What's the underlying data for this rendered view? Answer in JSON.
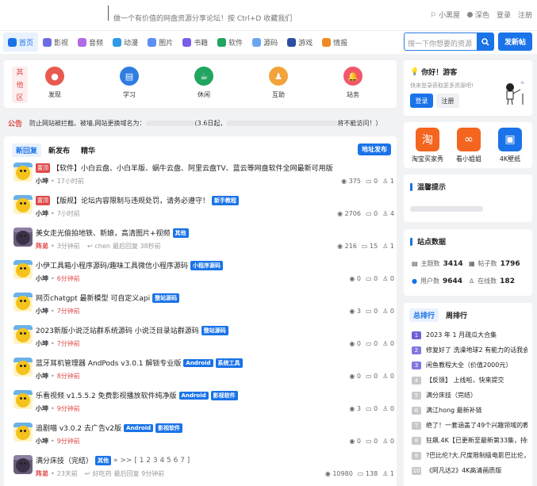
{
  "header": {
    "slogan": "做一个有价值的网盘资源分享论坛！按 Ctrl+D 收藏我们",
    "links": [
      "小黑屋",
      "深色",
      "登录",
      "注册"
    ]
  },
  "nav": {
    "items": [
      "首页",
      "影视",
      "音频",
      "动漫",
      "图片",
      "书籍",
      "软件",
      "源码",
      "游戏",
      "情报"
    ],
    "icon_colors": [
      "#1a73e8",
      "#6c6ce5",
      "#b06ae5",
      "#2f9be8",
      "#5b8ff0",
      "#7a5de8",
      "#22a560",
      "#6aa5f0",
      "#2b4fa3",
      "#f08a24"
    ],
    "search_placeholder": "搜一下你想要的资源",
    "post_button": "发新帖"
  },
  "quick": {
    "category": "其他区",
    "items": [
      "发现",
      "学习",
      "休闲",
      "互助",
      "站务"
    ],
    "colors": [
      "#e85a4f",
      "#2f7de1",
      "#22a560",
      "#f2a33a",
      "#f2566a"
    ]
  },
  "notice": {
    "tag": "公告",
    "text_a": "防止网站被拦截、被墙,网站更换域名为：",
    "text_b": "(3.6日起，",
    "text_c": "将不能访问！）"
  },
  "feed": {
    "tabs": [
      "新回复",
      "新发布",
      "精华"
    ],
    "address_button": "地址发布",
    "posts": [
      {
        "top": "置顶",
        "title": "【软件】小白云盘、小白羊版、蜗牛云盘、阿里云盘TV、蓝云等网盘软件全网最新可用版",
        "labels": [],
        "author": "小坤",
        "time": "17小时前",
        "reply_user": "",
        "reply_time": "",
        "views": "375",
        "replies": "0",
        "likes": "1",
        "dark": false
      },
      {
        "top": "置顶",
        "title": "【版规】论坛内容限制与违规处罚，请务必遵守！",
        "labels": [
          "新手教程"
        ],
        "author": "小坤",
        "time": "7小时前",
        "reply_user": "",
        "reply_time": "",
        "views": "2706",
        "replies": "0",
        "likes": "4",
        "dark": false
      },
      {
        "top": "",
        "title": "美女走光偷拍地铁、新娘，高清图片+视频",
        "labels": [
          "其他"
        ],
        "author": "阵弟",
        "time": "3分钟前",
        "reply_user": "chen",
        "reply_time": "最后回复 38秒前",
        "views": "216",
        "replies": "15",
        "likes": "1",
        "dark": true
      },
      {
        "top": "",
        "title": "小伊工具箱小程序源码/趣味工具微信小程序源码",
        "labels": [
          "小程序源码"
        ],
        "author": "小坤",
        "time": "6分钟前",
        "reply_user": "",
        "reply_time": "",
        "views": "0",
        "replies": "0",
        "likes": "0",
        "dark": false
      },
      {
        "top": "",
        "title": "网页chatgpt 最新模型 可自定义api",
        "labels": [
          "整站源码"
        ],
        "author": "小坤",
        "time": "7分钟前",
        "reply_user": "",
        "reply_time": "",
        "views": "3",
        "replies": "0",
        "likes": "0",
        "dark": false
      },
      {
        "top": "",
        "title": "2023新版小说泛站群系统源码 小说泛目录站群源码",
        "labels": [
          "整站源码"
        ],
        "author": "小坤",
        "time": "7分钟前",
        "reply_user": "",
        "reply_time": "",
        "views": "0",
        "replies": "0",
        "likes": "0",
        "dark": false
      },
      {
        "top": "",
        "title": "蓝牙耳机管理器 AndPods v3.0.1 解锁专业版",
        "labels": [
          "Android",
          "系统工具"
        ],
        "author": "小坤",
        "time": "8分钟前",
        "reply_user": "",
        "reply_time": "",
        "views": "0",
        "replies": "0",
        "likes": "0",
        "dark": false
      },
      {
        "top": "",
        "title": "乐看视频 v1.5.5.2 免费影视播放软件纯净版",
        "labels": [
          "Android",
          "影视软件"
        ],
        "author": "小坤",
        "time": "9分钟前",
        "reply_user": "",
        "reply_time": "",
        "views": "3",
        "replies": "0",
        "likes": "0",
        "dark": false
      },
      {
        "top": "",
        "title": "追剧喵 v3.0.2 去广告v2版",
        "labels": [
          "Android",
          "影视软件"
        ],
        "author": "小坤",
        "time": "9分钟前",
        "reply_user": "",
        "reply_time": "",
        "views": "0",
        "replies": "0",
        "likes": "0",
        "dark": false
      },
      {
        "top": "",
        "title": "满分床技（完结）",
        "labels": [
          "其他"
        ],
        "pages": "» >> [ 1 2 3 4 5 6 7 ]",
        "author": "阵弟",
        "time": "23天前",
        "reply_user": "好吃药",
        "reply_time": "最后回复 9分钟前",
        "views": "10980",
        "replies": "138",
        "likes": "1",
        "dark": true
      }
    ]
  },
  "sidebar": {
    "greeting": "你好！游客",
    "hint": "快来登录获取更多资源吧!",
    "login": "登录",
    "register": "注册",
    "apps": [
      {
        "name": "淘宝买家秀",
        "color": "#f4651f",
        "glyph": "淘"
      },
      {
        "name": "看小姐姐",
        "color": "#f4651f",
        "glyph": "∞"
      },
      {
        "name": "4K壁纸",
        "color": "#1a73e8",
        "glyph": "▣"
      }
    ],
    "warm_title": "温馨提示",
    "stats_title": "站点数据",
    "stats": {
      "topics_label": "主题数",
      "topics": "3414",
      "posts_label": "帖子数",
      "posts": "1796",
      "users_label": "用户数",
      "users": "9644",
      "online_label": "在线数",
      "online": "182"
    },
    "rank_tabs": [
      "总排行",
      "周排行"
    ],
    "rank": [
      "2023 年 1 月疏瓜大合集",
      "修复好了 洗澡地球2 有能力的话我会",
      "闲鱼教程大全（价值2000元）",
      "【反馈】                上线啦，快来提交",
      "满分床技（完结）",
      "满江hong 最新补链",
      "绝了！一套涵盖了49个兴趣领域的教",
      "狂飙.4K【已更新至最新第33集，持续",
      "?巴比伦?大.尺度限制级电影巴比伦，布",
      "《阿凡达2》4K高清画质版"
    ]
  }
}
